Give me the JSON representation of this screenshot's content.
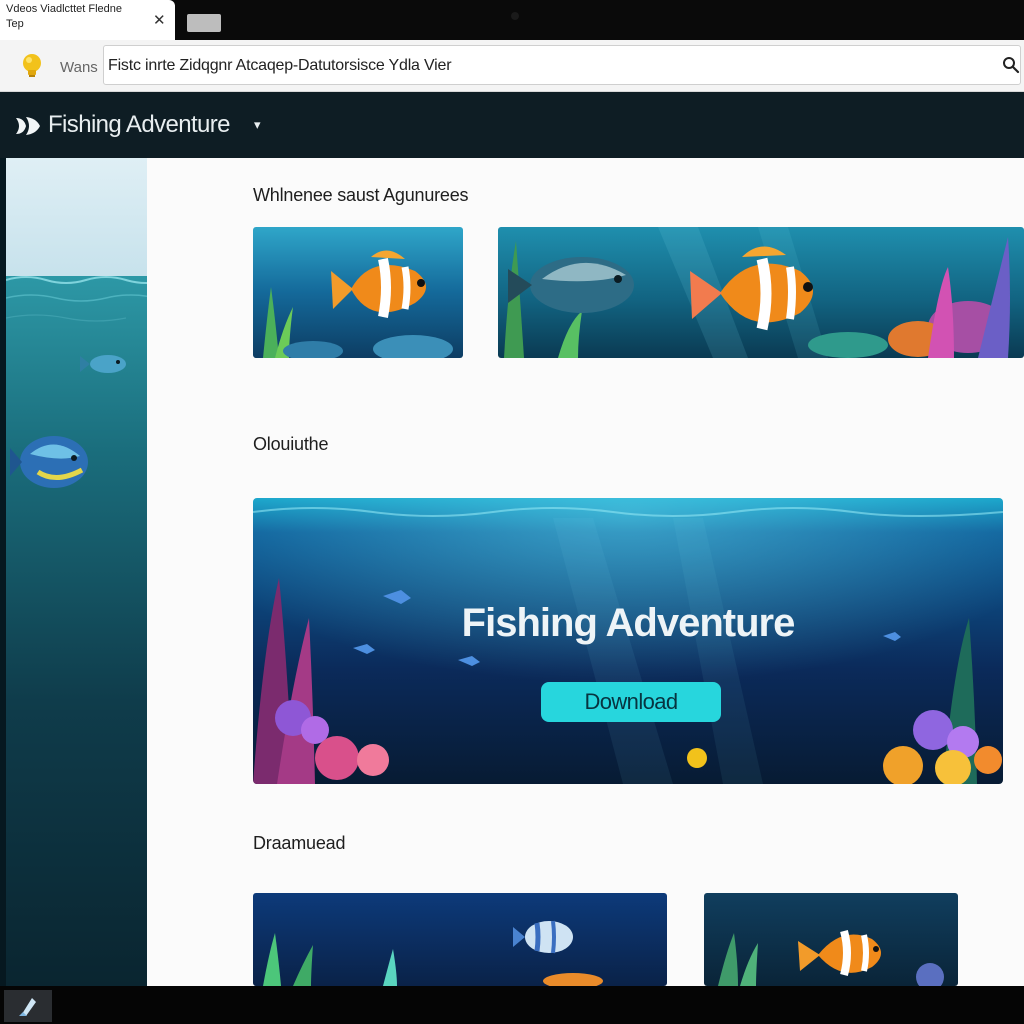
{
  "browser": {
    "tab_title_line1": "Vdeos Viadlcttet Fledne",
    "tab_title_line2": "Tep",
    "tab_close": "✕",
    "address_prefix": "Wans",
    "url": "Fistc inrte Zidqgnr Atcaqep-Datutorsisce Ydla Vier"
  },
  "header": {
    "site_title": "Fishing Adventure",
    "caret": "▾"
  },
  "main": {
    "section1_heading": "Whlnenee saust Agunurees",
    "section2_heading": "Olouiuthe",
    "hero_title": "Fishing Adventure",
    "hero_button": "Download",
    "section3_heading": "Draamuead"
  },
  "colors": {
    "accent": "#27d6dd",
    "header_bg": "#0e1d24",
    "ocean_dark": "#0b2a52"
  },
  "icons": {
    "site": "lightbulb-icon",
    "logo": "fishing-logo-icon",
    "search": "search-icon",
    "start": "start-icon"
  }
}
